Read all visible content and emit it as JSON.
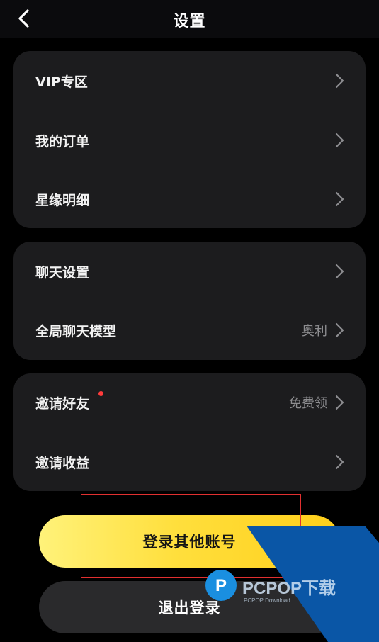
{
  "header": {
    "title": "设置",
    "back_icon": "chevron-left-icon"
  },
  "sections": [
    {
      "items": [
        {
          "label": "VIP专区",
          "value": ""
        },
        {
          "label": "我的订单",
          "value": ""
        },
        {
          "label": "星缘明细",
          "value": ""
        }
      ]
    },
    {
      "items": [
        {
          "label": "聊天设置",
          "value": ""
        },
        {
          "label": "全局聊天模型",
          "value": "奥利"
        }
      ]
    },
    {
      "items": [
        {
          "label": "邀请好友",
          "value": "免费领",
          "badge": "red-dot"
        },
        {
          "label": "邀请收益",
          "value": ""
        }
      ]
    }
  ],
  "actions": {
    "switch_account_label": "登录其他账号",
    "logout_label": "退出登录"
  },
  "watermark": {
    "brand": "PCPOP下载",
    "sub": "PCPOP Download"
  },
  "colors": {
    "background": "#000000",
    "card": "#1c1c1e",
    "primary_gradient_start": "#fff27a",
    "primary_gradient_end": "#ffcf1a",
    "secondary_button": "#2a2a2c",
    "badge_dot": "#ff3b3b",
    "highlight_box": "#e23030",
    "watermark_blue": "#0a56a6"
  }
}
